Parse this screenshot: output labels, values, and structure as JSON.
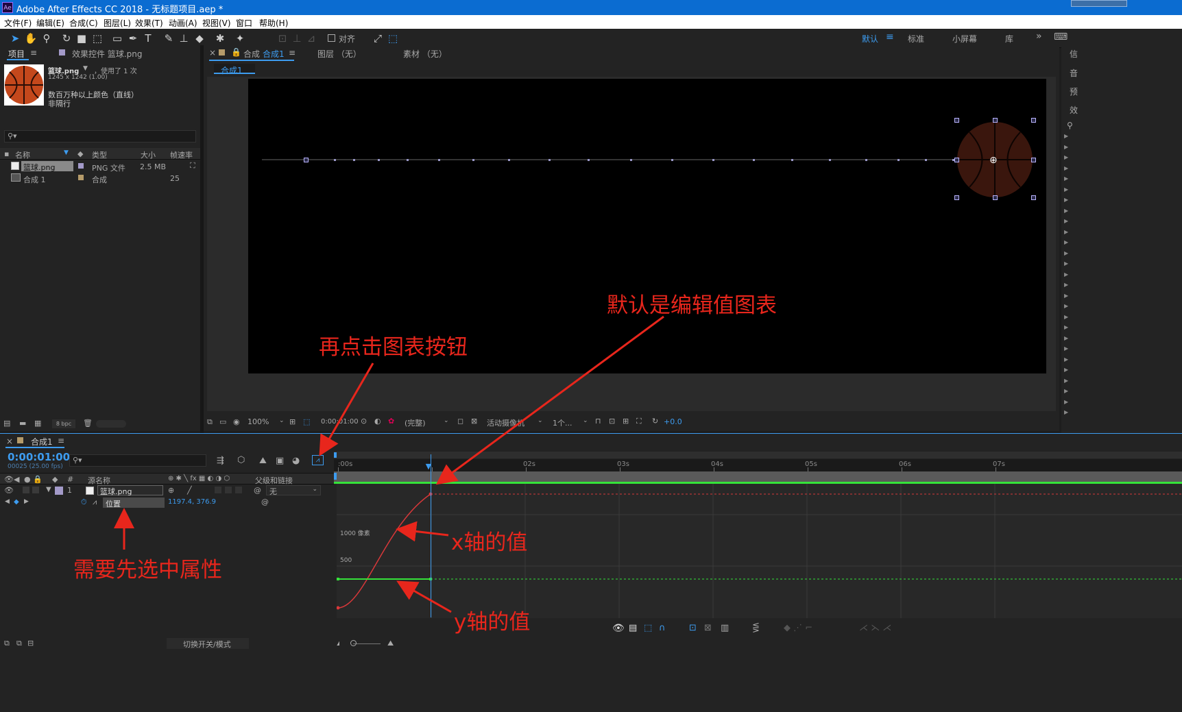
{
  "window": {
    "title": "Adobe After Effects CC 2018 - 无标题项目.aep *",
    "app_icon": "Ae"
  },
  "menu": [
    "文件(F)",
    "编辑(E)",
    "合成(C)",
    "图层(L)",
    "效果(T)",
    "动画(A)",
    "视图(V)",
    "窗口",
    "帮助(H)"
  ],
  "toolbar": {
    "align_label": "对齐",
    "workspaces": [
      "默认",
      "标准",
      "小屏幕",
      "库"
    ],
    "active_workspace": "默认"
  },
  "project_panel": {
    "tab_label": "项目",
    "effects_tab": "效果控件 篮球.png",
    "asset": {
      "name": "篮球.png",
      "usage": "，使用了 1 次",
      "dimensions": "1245 x 1242 (1.00)",
      "color_info": "数百万种以上颜色（直线）",
      "interlace": "非隔行"
    },
    "columns": [
      "名称",
      "类型",
      "大小",
      "帧速率"
    ],
    "items": [
      {
        "name": "篮球.png",
        "type": "PNG 文件",
        "size": "2.5 MB",
        "fps": ""
      },
      {
        "name": "合成 1",
        "type": "合成",
        "size": "",
        "fps": "25"
      }
    ],
    "bpc": "8 bpc"
  },
  "composition_panel": {
    "tab_label": "合成",
    "tab_name": "合成1",
    "layer_tab": "图层 （无）",
    "footage_tab": "素材 （无）",
    "breadcrumb": "合成1",
    "footer": {
      "zoom": "100%",
      "timecode": "0:00:01:00",
      "resolution": "(完整)",
      "camera": "活动摄像机",
      "views": "1个...",
      "exposure": "+0.0"
    }
  },
  "right_panel": {
    "tabs": [
      "信",
      "音",
      "预",
      "效"
    ]
  },
  "timeline": {
    "tab_label": "合成1",
    "timecode": "0:00:01:00",
    "frame_info": "00025 (25.00 fps)",
    "columns": {
      "num": "#",
      "source": "源名称",
      "parent": "父级和链接"
    },
    "layer": {
      "index": "1",
      "name": "篮球.png",
      "parent": "无"
    },
    "property": {
      "name": "位置",
      "value": "1197.4, 376.9"
    },
    "ruler": [
      ":00s",
      "01s",
      "02s",
      "03s",
      "04s",
      "05s",
      "06s",
      "07s"
    ],
    "graph_labels": [
      "1000 像素",
      "500"
    ],
    "footer_label": "切换开关/模式",
    "graph": {
      "playhead_time": "01s",
      "x_axis": {
        "start": 0,
        "end": 1197.4
      },
      "y_axis": {
        "value": 376.9
      }
    }
  },
  "annotations": {
    "default_graph": "默认是编辑值图表",
    "click_graph_button": "再点击图表按钮",
    "x_value": "x轴的值",
    "select_property": "需要先选中属性",
    "y_value": "y轴的值"
  },
  "colors": {
    "accent": "#3d9cf0",
    "annotation": "#e8261c",
    "x_curve": "#d9383a",
    "y_curve": "#35e23a",
    "titlebar": "#0b6cd1"
  }
}
